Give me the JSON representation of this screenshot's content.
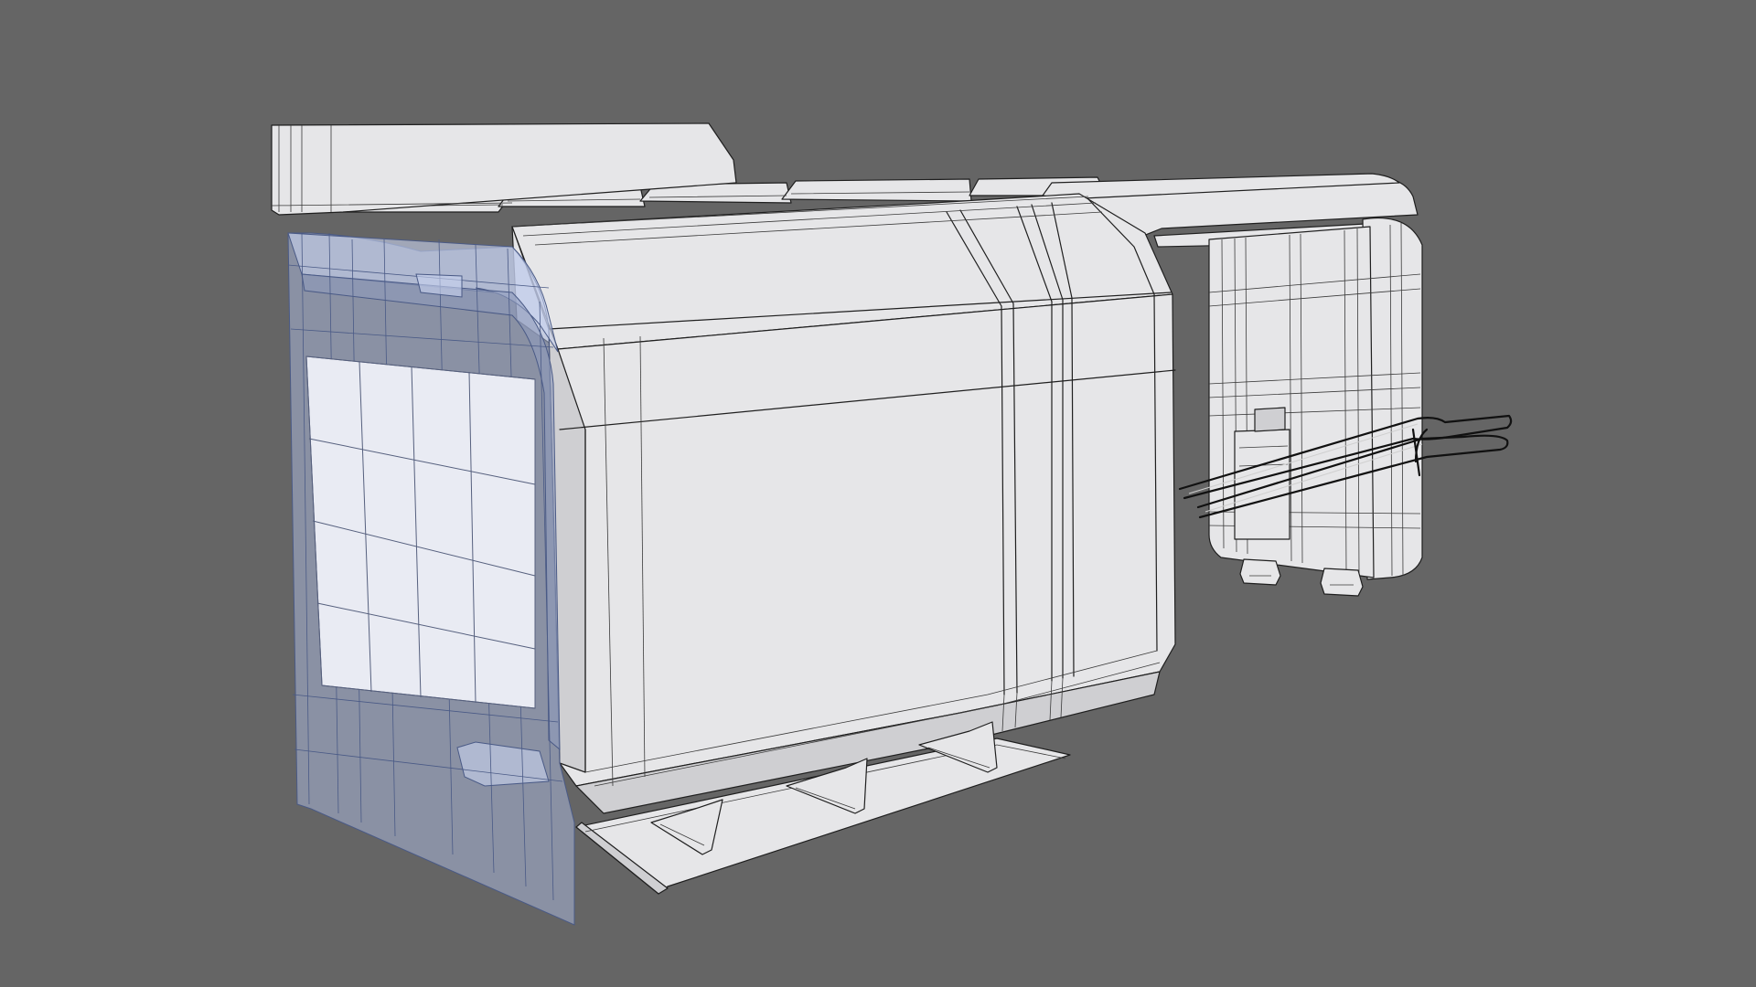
{
  "scene": {
    "background_color": "#656565",
    "surface_color": "#e6e6e8",
    "glass_color": "#a9b6d8",
    "wire_color": "#1f1f1f"
  }
}
